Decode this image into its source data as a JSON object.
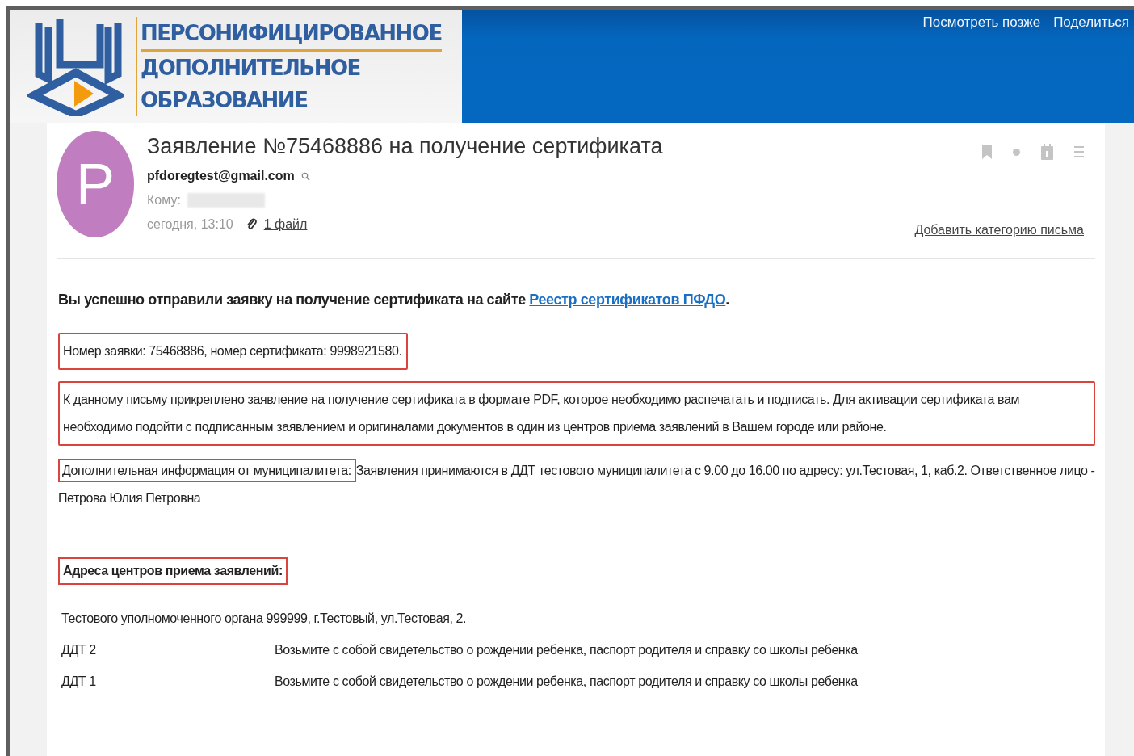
{
  "header": {
    "logo_lines": [
      "ПЕРСОНИФИЦИРОВАННОЕ",
      "ДОПОЛНИТЕЛЬНОЕ",
      "ОБРАЗОВАНИЕ"
    ],
    "actions": [
      "Посмотреть позже",
      "Поделиться"
    ]
  },
  "email": {
    "avatar_letter": "P",
    "subject": "Заявление №75468886 на получение сертификата",
    "sender": "pfdoregtest@gmail.com",
    "to_label": "Кому:",
    "date": "сегодня, 13:10",
    "attachments": "1 файл",
    "add_category": "Добавить категорию письма"
  },
  "body": {
    "intro": {
      "text": "Вы успешно отправили заявку на получение сертификата на сайте ",
      "link": "Реестр сертификатов ПФДО",
      "after": "."
    },
    "blocks": [
      {
        "kind": "boxed",
        "text": "Номер заявки: 75468886, номер сертификата: 9998921580."
      },
      {
        "kind": "boxed",
        "text": "К данному письму прикреплено заявление на получение сертификата в формате PDF, которое необходимо распечатать и подписать. Для активации сертификата вам необходимо подойти с подписанным заявлением и оригиналами документов в один из центров приема заявлений в Вашем городе или районе."
      },
      {
        "kind": "labeled",
        "label": "Дополнительная информация от муниципалитета:",
        "text": "Заявления принимаются в ДДТ тестового муниципалитета с 9.00 до 16.00 по адресу: ул.Тестовая, 1, каб.2. Ответственное лицо - Петрова Юлия Петровна"
      },
      {
        "kind": "heading",
        "text": "Адреса центров приема заявлений:"
      }
    ],
    "address": "Тестового уполномоченного органа 999999, г.Тестовый, ул.Тестовая, 2.",
    "centers": [
      {
        "name": "ДДТ 2",
        "note": "Возьмите с собой свидетельство о рождении ребенка, паспорт родителя и справку со школы ребенка"
      },
      {
        "name": "ДДТ 1",
        "note": "Возьмите с собой свидетельство о рождении ребенка, паспорт родителя и справку со школы ребенка"
      }
    ]
  }
}
